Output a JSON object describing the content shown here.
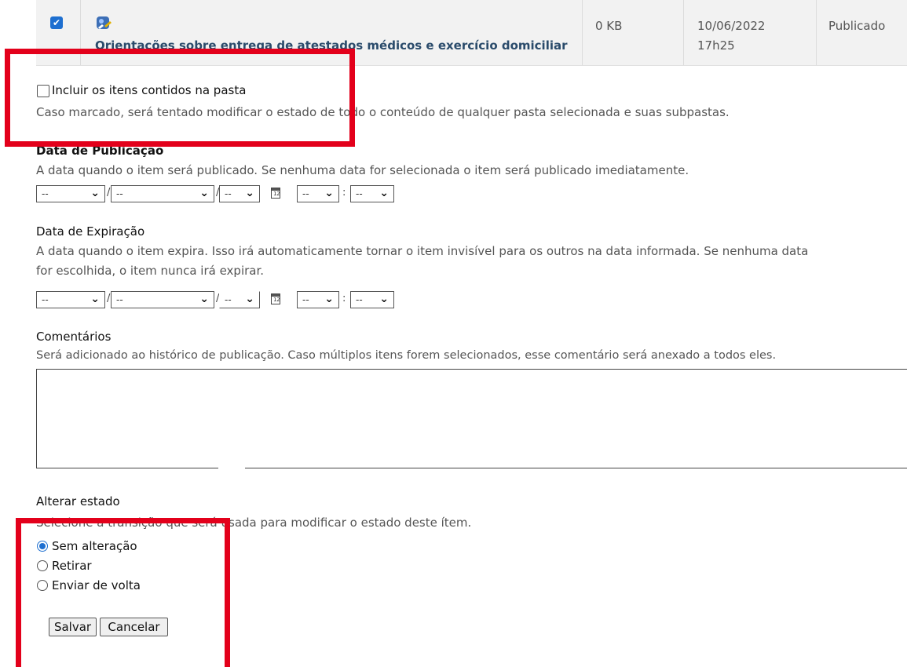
{
  "row": {
    "title": "Orientações sobre entrega de atestados médicos e exercício domiciliar",
    "size": "0 KB",
    "date": "10/06/2022",
    "time": "17h25",
    "status": "Publicado",
    "checked": true
  },
  "include": {
    "label": "Incluir os itens contidos na pasta",
    "help": "Caso marcado, será tentado modificar o estado de todo o conteúdo de qualquer pasta selecionada e suas subpastas."
  },
  "publication": {
    "label": "Data de Publicação",
    "help": "A data quando o item será publicado. Se nenhuma data for selecionada o item será publicado imediatamente.",
    "day": "--",
    "month": "--",
    "year": "--",
    "hour": "--",
    "minute": "--"
  },
  "expiration": {
    "label": "Data de Expiração",
    "help_line1": "A data quando o item expira. Isso irá automaticamente tornar o item invisível para os outros na data informada. Se nenhuma data",
    "help_line2": "for escolhida, o item nunca irá expirar.",
    "day": "--",
    "month": "--",
    "year": "--",
    "hour": "--",
    "minute": "--"
  },
  "comments": {
    "label": "Comentários",
    "help": "Será adicionado ao histórico de publicação. Caso múltiplos itens forem selecionados, esse comentário será anexado a todos eles."
  },
  "state": {
    "label": "Alterar estado",
    "help": "Selecione a transição que será usada para modificar o estado deste ítem.",
    "options": [
      "Sem alteração",
      "Retirar",
      "Enviar de volta"
    ],
    "selected": "Sem alteração"
  },
  "buttons": {
    "save": "Salvar",
    "cancel": "Cancelar"
  },
  "colors": {
    "highlight": "#e3001b",
    "accent": "#1e6fd0",
    "link": "#2a4b6b"
  }
}
